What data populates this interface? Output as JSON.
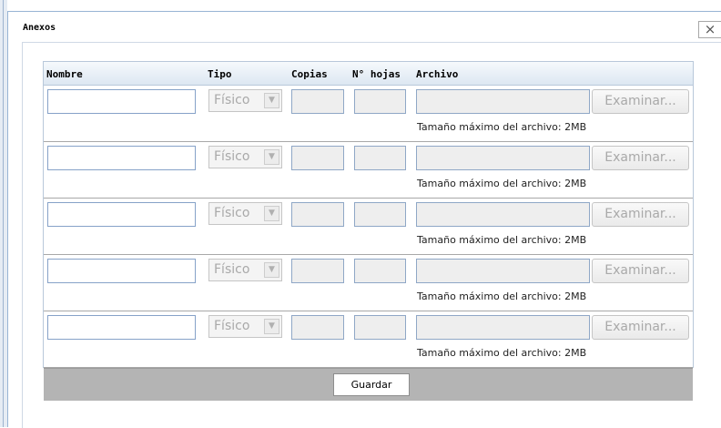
{
  "dialog": {
    "title": "Anexos",
    "close_label": "×"
  },
  "table": {
    "headers": [
      "Nombre",
      "Tipo",
      "Copias",
      "N° hojas",
      "Archivo"
    ],
    "rows": [
      {
        "nombre": "",
        "tipo": "Físico",
        "copias": "",
        "hojas": "",
        "archivo": "",
        "browse_label": "Examinar...",
        "max_size_note": "Tamaño máximo del archivo: 2MB"
      },
      {
        "nombre": "",
        "tipo": "Físico",
        "copias": "",
        "hojas": "",
        "archivo": "",
        "browse_label": "Examinar...",
        "max_size_note": "Tamaño máximo del archivo: 2MB"
      },
      {
        "nombre": "",
        "tipo": "Físico",
        "copias": "",
        "hojas": "",
        "archivo": "",
        "browse_label": "Examinar...",
        "max_size_note": "Tamaño máximo del archivo: 2MB"
      },
      {
        "nombre": "",
        "tipo": "Físico",
        "copias": "",
        "hojas": "",
        "archivo": "",
        "browse_label": "Examinar...",
        "max_size_note": "Tamaño máximo del archivo: 2MB"
      },
      {
        "nombre": "",
        "tipo": "Físico",
        "copias": "",
        "hojas": "",
        "archivo": "",
        "browse_label": "Examinar...",
        "max_size_note": "Tamaño máximo del archivo: 2MB"
      }
    ]
  },
  "footer": {
    "save_label": "Guardar"
  },
  "colors": {
    "header_gradient_end": "#dde7f2",
    "footer_bg": "#b4b4b4",
    "input_border": "#86a2c8",
    "disabled_bg": "#eeeeee"
  },
  "icons": {
    "close": "close-icon",
    "select_arrow": "chevron-down-icon"
  }
}
